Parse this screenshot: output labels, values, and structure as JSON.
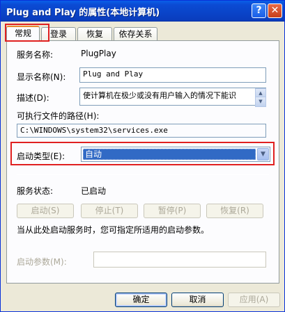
{
  "window": {
    "title": "Plug and Play 的属性(本地计算机)",
    "help_label": "?",
    "close_label": "✕"
  },
  "tabs": [
    {
      "label": "常规"
    },
    {
      "label": "登录"
    },
    {
      "label": "恢复"
    },
    {
      "label": "依存关系"
    }
  ],
  "general": {
    "service_name_label": "服务名称:",
    "service_name": "PlugPlay",
    "display_name_label": "显示名称(N):",
    "display_name": "Plug and Play",
    "description_label": "描述(D):",
    "description": "使计算机在极少或没有用户输入的情况下能识",
    "exe_path_label": "可执行文件的路径(H):",
    "exe_path": "C:\\WINDOWS\\system32\\services.exe",
    "startup_type_label": "启动类型(E):",
    "startup_type": "自动",
    "status_label": "服务状态:",
    "status": "已启动",
    "start_button": "启动(S)",
    "stop_button": "停止(T)",
    "pause_button": "暂停(P)",
    "resume_button": "恢复(R)",
    "hint": "当从此处启动服务时，您可指定所适用的启动参数。",
    "start_params_label": "启动参数(M):",
    "start_params": ""
  },
  "footer": {
    "ok": "确定",
    "cancel": "取消",
    "apply": "应用(A)"
  },
  "icons": {
    "scroll_up": "▲",
    "scroll_down": "▼",
    "dropdown": "▼"
  },
  "colors": {
    "title_bar": "#0a44c8",
    "highlight_box": "#e02020",
    "selection": "#316ac5"
  }
}
